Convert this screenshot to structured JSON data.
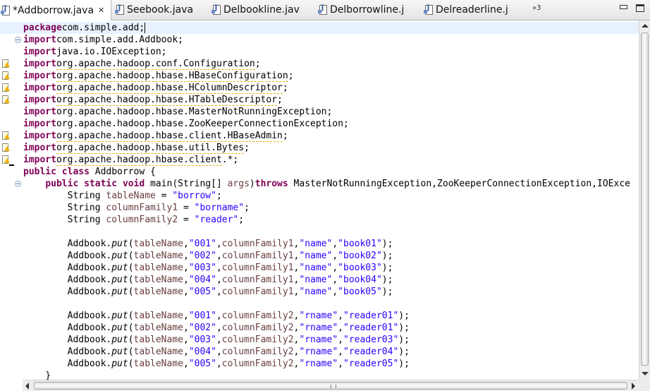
{
  "tabs": [
    {
      "label": "*Addborrow.java",
      "active": true,
      "closable": true
    },
    {
      "label": "Seebook.java",
      "active": false
    },
    {
      "label": "Delbookline.jav",
      "active": false
    },
    {
      "label": "Delborrowline.j",
      "active": false
    },
    {
      "label": "Delreaderline.j",
      "active": false
    }
  ],
  "overflow_label": "»3",
  "icons": {
    "file": "java-file-icon",
    "warning": "warning-icon",
    "fold": "fold-icon"
  },
  "colors": {
    "keyword": "#7f0055",
    "string": "#2a00ff",
    "variable": "#6a3e3e",
    "current_line": "#e8f2fe"
  },
  "code": {
    "lines": [
      [
        [
          "kw",
          "package"
        ],
        [
          "",
          "com.simple.add;"
        ]
      ],
      [
        [
          "kw",
          "import"
        ],
        [
          "",
          "com.simple.add.Addbook;"
        ]
      ],
      [
        [
          "kw",
          "import"
        ],
        [
          "",
          "java.io.IOException;"
        ]
      ],
      [
        [
          "kw",
          "import"
        ],
        [
          "w",
          "org.apache.hadoop.conf.Configuration"
        ],
        [
          "",
          ";"
        ]
      ],
      [
        [
          "kw",
          "import"
        ],
        [
          "w",
          "org.apache.hadoop.hbase.HBaseConfiguration"
        ],
        [
          "",
          ";"
        ]
      ],
      [
        [
          "kw",
          "import"
        ],
        [
          "w",
          "org.apache.hadoop.hbase.HColumnDescriptor"
        ],
        [
          "",
          ";"
        ]
      ],
      [
        [
          "kw",
          "import"
        ],
        [
          "w",
          "org.apache.hadoop.hbase.HTableDescriptor"
        ],
        [
          "",
          ";"
        ]
      ],
      [
        [
          "kw",
          "import"
        ],
        [
          "",
          "org.apache.hadoop.hbase.MasterNotRunningException;"
        ]
      ],
      [
        [
          "kw",
          "import"
        ],
        [
          "",
          "org.apache.hadoop.hbase.ZooKeeperConnectionException;"
        ]
      ],
      [
        [
          "kw",
          "import"
        ],
        [
          "w",
          "org.apache.hadoop.hbase.client.HBaseAdmin"
        ],
        [
          "",
          ";"
        ]
      ],
      [
        [
          "kw",
          "import"
        ],
        [
          "w",
          "org.apache.hadoop.hbase.util.Bytes"
        ],
        [
          "",
          ";"
        ]
      ],
      [
        [
          "kw",
          "import"
        ],
        [
          "w",
          "org.apache.hadoop.hbase.client"
        ],
        [
          "",
          ".*;"
        ]
      ],
      [
        [
          "kw",
          "public class"
        ],
        [
          "",
          " Addborrow {"
        ]
      ],
      [
        [
          "",
          "    "
        ],
        [
          "kw",
          "public static void"
        ],
        [
          "",
          " main(String[] "
        ],
        [
          "var",
          "args"
        ],
        [
          "",
          ")"
        ],
        [
          "kw",
          "throws"
        ],
        [
          "",
          " MasterNotRunningException,ZooKeeperConnectionException,IOExce"
        ]
      ],
      [
        [
          "",
          "        String "
        ],
        [
          "var",
          "tableName"
        ],
        [
          "",
          " = "
        ],
        [
          "str",
          "\"borrow\""
        ],
        [
          "",
          ";"
        ]
      ],
      [
        [
          "",
          "        String "
        ],
        [
          "var",
          "columnFamily1"
        ],
        [
          "",
          " = "
        ],
        [
          "str",
          "\"borname\""
        ],
        [
          "",
          ";"
        ]
      ],
      [
        [
          "",
          "        String "
        ],
        [
          "var",
          "columnFamily2"
        ],
        [
          "",
          " = "
        ],
        [
          "str",
          "\"reader\""
        ],
        [
          "",
          ";"
        ]
      ],
      [
        [
          "",
          ""
        ]
      ],
      [
        [
          "",
          "        Addbook."
        ],
        [
          "it",
          "put"
        ],
        [
          "",
          "("
        ],
        [
          "var",
          "tableName"
        ],
        [
          "",
          ","
        ],
        [
          "str",
          "\"001\""
        ],
        [
          "",
          ","
        ],
        [
          "var",
          "columnFamily1"
        ],
        [
          "",
          ","
        ],
        [
          "str",
          "\"name\""
        ],
        [
          "",
          ","
        ],
        [
          "str",
          "\"book01\""
        ],
        [
          "",
          ");"
        ]
      ],
      [
        [
          "",
          "        Addbook."
        ],
        [
          "it",
          "put"
        ],
        [
          "",
          "("
        ],
        [
          "var",
          "tableName"
        ],
        [
          "",
          ","
        ],
        [
          "str",
          "\"002\""
        ],
        [
          "",
          ","
        ],
        [
          "var",
          "columnFamily1"
        ],
        [
          "",
          ","
        ],
        [
          "str",
          "\"name\""
        ],
        [
          "",
          ","
        ],
        [
          "str",
          "\"book02\""
        ],
        [
          "",
          ");"
        ]
      ],
      [
        [
          "",
          "        Addbook."
        ],
        [
          "it",
          "put"
        ],
        [
          "",
          "("
        ],
        [
          "var",
          "tableName"
        ],
        [
          "",
          ","
        ],
        [
          "str",
          "\"003\""
        ],
        [
          "",
          ","
        ],
        [
          "var",
          "columnFamily1"
        ],
        [
          "",
          ","
        ],
        [
          "str",
          "\"name\""
        ],
        [
          "",
          ","
        ],
        [
          "str",
          "\"book03\""
        ],
        [
          "",
          ");"
        ]
      ],
      [
        [
          "",
          "        Addbook."
        ],
        [
          "it",
          "put"
        ],
        [
          "",
          "("
        ],
        [
          "var",
          "tableName"
        ],
        [
          "",
          ","
        ],
        [
          "str",
          "\"004\""
        ],
        [
          "",
          ","
        ],
        [
          "var",
          "columnFamily1"
        ],
        [
          "",
          ","
        ],
        [
          "str",
          "\"name\""
        ],
        [
          "",
          ","
        ],
        [
          "str",
          "\"book04\""
        ],
        [
          "",
          ");"
        ]
      ],
      [
        [
          "",
          "        Addbook."
        ],
        [
          "it",
          "put"
        ],
        [
          "",
          "("
        ],
        [
          "var",
          "tableName"
        ],
        [
          "",
          ","
        ],
        [
          "str",
          "\"005\""
        ],
        [
          "",
          ","
        ],
        [
          "var",
          "columnFamily1"
        ],
        [
          "",
          ","
        ],
        [
          "str",
          "\"name\""
        ],
        [
          "",
          ","
        ],
        [
          "str",
          "\"book05\""
        ],
        [
          "",
          ");"
        ]
      ],
      [
        [
          "",
          ""
        ]
      ],
      [
        [
          "",
          "        Addbook."
        ],
        [
          "it",
          "put"
        ],
        [
          "",
          "("
        ],
        [
          "var",
          "tableName"
        ],
        [
          "",
          ","
        ],
        [
          "str",
          "\"001\""
        ],
        [
          "",
          ","
        ],
        [
          "var",
          "columnFamily2"
        ],
        [
          "",
          ","
        ],
        [
          "str",
          "\"rname\""
        ],
        [
          "",
          ","
        ],
        [
          "str",
          "\"reader01\""
        ],
        [
          "",
          ");"
        ]
      ],
      [
        [
          "",
          "        Addbook."
        ],
        [
          "it",
          "put"
        ],
        [
          "",
          "("
        ],
        [
          "var",
          "tableName"
        ],
        [
          "",
          ","
        ],
        [
          "str",
          "\"002\""
        ],
        [
          "",
          ","
        ],
        [
          "var",
          "columnFamily2"
        ],
        [
          "",
          ","
        ],
        [
          "str",
          "\"rname\""
        ],
        [
          "",
          ","
        ],
        [
          "str",
          "\"reader01\""
        ],
        [
          "",
          ");"
        ]
      ],
      [
        [
          "",
          "        Addbook."
        ],
        [
          "it",
          "put"
        ],
        [
          "",
          "("
        ],
        [
          "var",
          "tableName"
        ],
        [
          "",
          ","
        ],
        [
          "str",
          "\"003\""
        ],
        [
          "",
          ","
        ],
        [
          "var",
          "columnFamily2"
        ],
        [
          "",
          ","
        ],
        [
          "str",
          "\"rname\""
        ],
        [
          "",
          ","
        ],
        [
          "str",
          "\"reader03\""
        ],
        [
          "",
          ");"
        ]
      ],
      [
        [
          "",
          "        Addbook."
        ],
        [
          "it",
          "put"
        ],
        [
          "",
          "("
        ],
        [
          "var",
          "tableName"
        ],
        [
          "",
          ","
        ],
        [
          "str",
          "\"004\""
        ],
        [
          "",
          ","
        ],
        [
          "var",
          "columnFamily2"
        ],
        [
          "",
          ","
        ],
        [
          "str",
          "\"rname\""
        ],
        [
          "",
          ","
        ],
        [
          "str",
          "\"reader04\""
        ],
        [
          "",
          ");"
        ]
      ],
      [
        [
          "",
          "        Addbook."
        ],
        [
          "it",
          "put"
        ],
        [
          "",
          "("
        ],
        [
          "var",
          "tableName"
        ],
        [
          "",
          ","
        ],
        [
          "str",
          "\"005\""
        ],
        [
          "",
          ","
        ],
        [
          "var",
          "columnFamily2"
        ],
        [
          "",
          ","
        ],
        [
          "str",
          "\"rname\""
        ],
        [
          "",
          ","
        ],
        [
          "str",
          "\"reader05\""
        ],
        [
          "",
          ");"
        ]
      ],
      [
        [
          "",
          "    }"
        ]
      ]
    ],
    "warning_lines": [
      3,
      4,
      5,
      6,
      9,
      10,
      11
    ],
    "fold_lines": [
      1,
      13
    ],
    "current_line": 0
  }
}
